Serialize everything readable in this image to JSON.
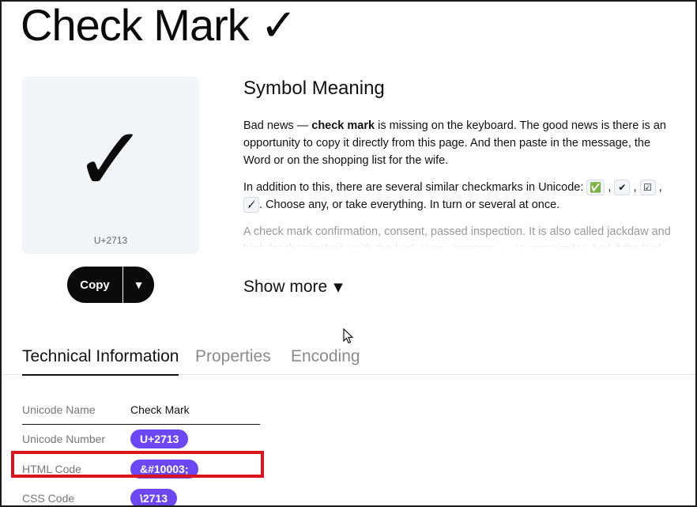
{
  "page": {
    "title": "Check Mark ✓"
  },
  "symbol": {
    "glyph": "✓",
    "codepoint": "U+2713",
    "copy_label": "Copy",
    "dropdown_glyph": "▼"
  },
  "meaning": {
    "heading": "Symbol Meaning",
    "p1_before": "Bad news — ",
    "p1_bold": "check mark",
    "p1_after": " is missing on the keyboard. The good news is there is an opportunity to copy it directly from this page. And then paste in the message, the Word or on the shopping list for the wife.",
    "p2_before": "In addition to this, there are several similar checkmarks in Unicode: ",
    "similar": [
      "✅",
      "✔",
      "☑",
      "✓̸"
    ],
    "separator": ",",
    "p2_end": ".",
    "p2_after": "Choose any, or take everything. In turn or several at once.",
    "p3": "A check mark confirmation, consent, passed inspection. It is also called jackdaw and bird, for the similarity with the bird. Here, compare ⩡ . Is very similar. And if the bird",
    "show_more": "Show more",
    "show_more_icon": "▼"
  },
  "tabs": [
    {
      "label": "Technical Information",
      "active": true
    },
    {
      "label": "Properties",
      "active": false
    },
    {
      "label": "Encoding",
      "active": false
    }
  ],
  "tech": {
    "rows": [
      {
        "label": "Unicode Name",
        "value": "Check Mark",
        "pill": false
      },
      {
        "label": "Unicode Number",
        "value": "U+2713",
        "pill": true
      },
      {
        "label": "HTML Code",
        "value": "&#10003;",
        "pill": true
      },
      {
        "label": "CSS Code",
        "value": "\\2713",
        "pill": true
      }
    ]
  },
  "colors": {
    "pill": "#6b47f5",
    "highlight": "#d9141c",
    "card_bg": "#f3f5f9",
    "copy_bg": "#0a0a0a"
  }
}
